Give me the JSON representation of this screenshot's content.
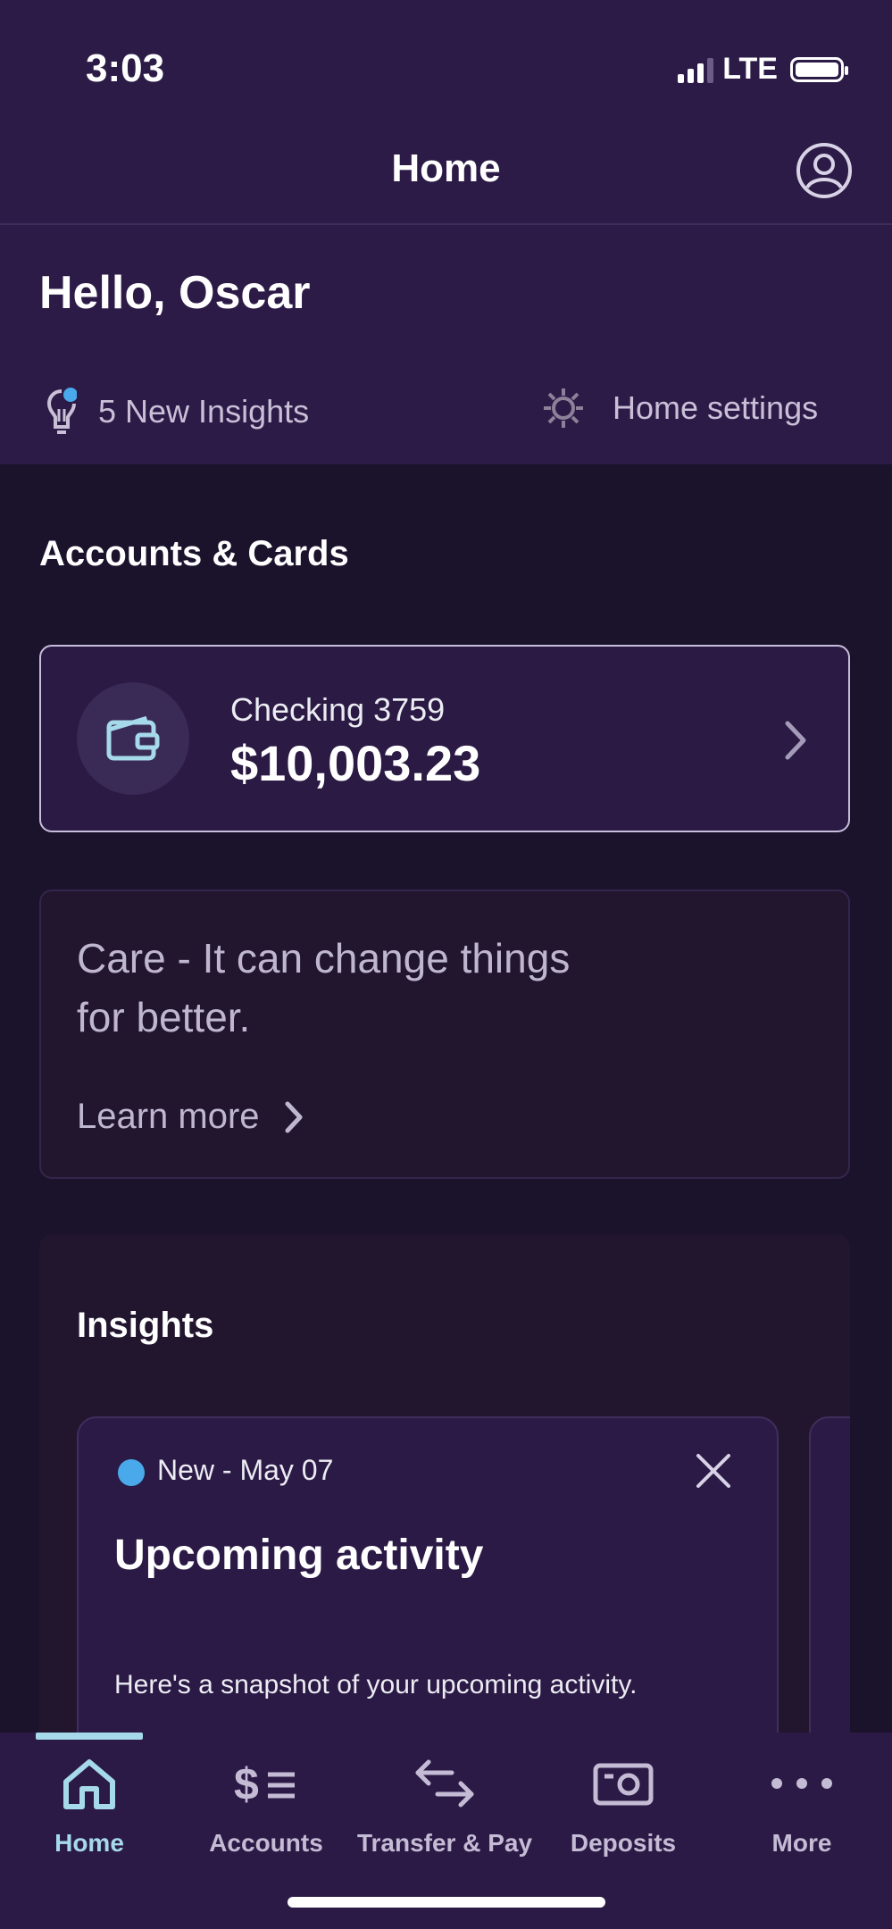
{
  "status_bar": {
    "time": "3:03",
    "network": "LTE"
  },
  "header": {
    "title": "Home"
  },
  "greeting": "Hello, Oscar",
  "quick_links": {
    "insights_label": "5 New Insights",
    "settings_label": "Home settings"
  },
  "accounts_section": {
    "title": "Accounts & Cards",
    "account": {
      "name": "Checking 3759",
      "balance": "$10,003.23"
    }
  },
  "promo": {
    "line1": "Care - It can change things",
    "line2": "for better.",
    "link_label": "Learn more"
  },
  "insights": {
    "title": "Insights",
    "card": {
      "tag": "New - May 07",
      "heading": "Upcoming activity",
      "body": "Here's a snapshot of your upcoming activity."
    }
  },
  "tab_bar": {
    "tabs": [
      {
        "label": "Home",
        "active": true
      },
      {
        "label": "Accounts"
      },
      {
        "label": "Transfer & Pay"
      },
      {
        "label": "Deposits"
      },
      {
        "label": "More"
      }
    ]
  },
  "colors": {
    "header_bg": "#2c1b47",
    "page_bg": "#1b122c",
    "accent": "#a6d9ea",
    "insight_dot": "#4aa9ea"
  },
  "icons": [
    "profile-icon",
    "lightbulb-icon",
    "gear-icon",
    "wallet-icon",
    "chevron-right-icon",
    "close-icon",
    "home-icon",
    "accounts-icon",
    "transfer-icon",
    "deposits-icon",
    "more-icon"
  ]
}
